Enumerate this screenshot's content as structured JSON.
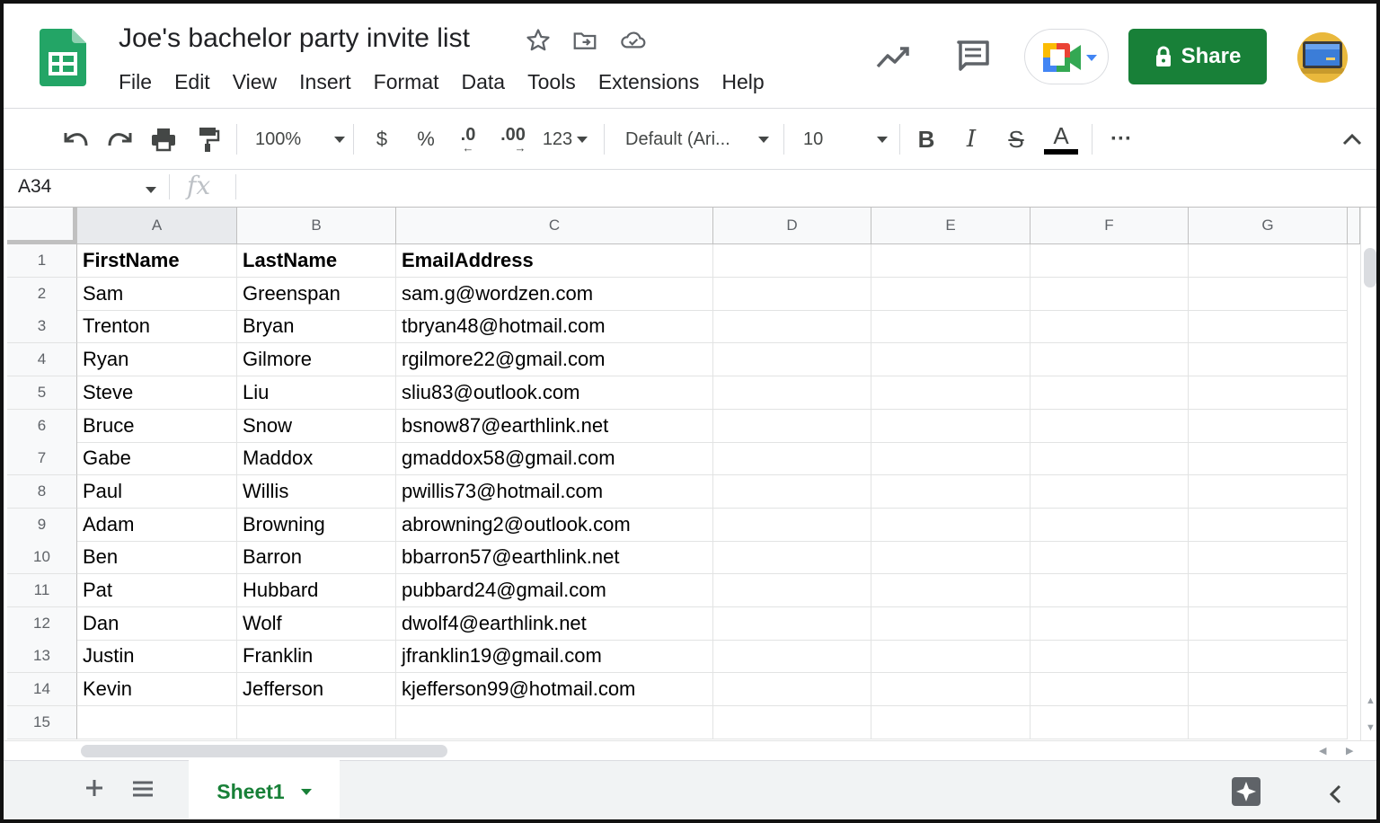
{
  "doc": {
    "title": "Joe's bachelor party invite list"
  },
  "menu": [
    "File",
    "Edit",
    "View",
    "Insert",
    "Format",
    "Data",
    "Tools",
    "Extensions",
    "Help"
  ],
  "share_label": "Share",
  "toolbar": {
    "zoom": "100%",
    "currency": "$",
    "percent": "%",
    "dec_decrease": ".0",
    "dec_increase": ".00",
    "more_formats": "123",
    "font": "Default (Ari...",
    "font_size": "10",
    "bold": "B",
    "italic": "I",
    "strike": "S",
    "text_color": "A",
    "more": "···"
  },
  "formula_bar": {
    "name_box": "A34",
    "fx": "fx"
  },
  "grid": {
    "columns": [
      "A",
      "B",
      "C",
      "D",
      "E",
      "F",
      "G"
    ],
    "rows": [
      {
        "num": "1",
        "cells": [
          "FirstName",
          "LastName",
          "EmailAddress"
        ]
      },
      {
        "num": "2",
        "cells": [
          "Sam",
          "Greenspan",
          "sam.g@wordzen.com"
        ]
      },
      {
        "num": "3",
        "cells": [
          "Trenton",
          "Bryan",
          "tbryan48@hotmail.com"
        ]
      },
      {
        "num": "4",
        "cells": [
          "Ryan",
          "Gilmore",
          "rgilmore22@gmail.com"
        ]
      },
      {
        "num": "5",
        "cells": [
          "Steve",
          "Liu",
          "sliu83@outlook.com"
        ]
      },
      {
        "num": "6",
        "cells": [
          "Bruce",
          "Snow",
          "bsnow87@earthlink.net"
        ]
      },
      {
        "num": "7",
        "cells": [
          "Gabe",
          "Maddox",
          "gmaddox58@gmail.com"
        ]
      },
      {
        "num": "8",
        "cells": [
          "Paul",
          "Willis",
          "pwillis73@hotmail.com"
        ]
      },
      {
        "num": "9",
        "cells": [
          "Adam",
          "Browning",
          "abrowning2@outlook.com"
        ]
      },
      {
        "num": "10",
        "cells": [
          "Ben",
          "Barron",
          "bbarron57@earthlink.net"
        ]
      },
      {
        "num": "11",
        "cells": [
          "Pat",
          "Hubbard",
          "pubbard24@gmail.com"
        ]
      },
      {
        "num": "12",
        "cells": [
          "Dan",
          "Wolf",
          "dwolf4@earthlink.net"
        ]
      },
      {
        "num": "13",
        "cells": [
          "Justin",
          "Franklin",
          "jfranklin19@gmail.com"
        ]
      },
      {
        "num": "14",
        "cells": [
          "Kevin",
          "Jefferson",
          "kjefferson99@hotmail.com"
        ]
      },
      {
        "num": "15",
        "cells": [
          "",
          "",
          ""
        ]
      }
    ]
  },
  "sheet_tab": "Sheet1",
  "colors": {
    "brand_green": "#188038",
    "sheets_logo": "#23a566"
  },
  "icons": {
    "header": [
      "star-icon",
      "move-to-folder-icon",
      "cloud-status-icon",
      "activity-trend-icon",
      "comments-icon",
      "google-meet-icon",
      "lock-icon",
      "avatar"
    ],
    "toolbar": [
      "undo-icon",
      "redo-icon",
      "print-icon",
      "paint-format-icon",
      "collapse-toolbar-icon"
    ],
    "bottom": [
      "add-sheet-icon",
      "all-sheets-icon",
      "explore-icon",
      "side-panel-toggle-icon"
    ]
  }
}
